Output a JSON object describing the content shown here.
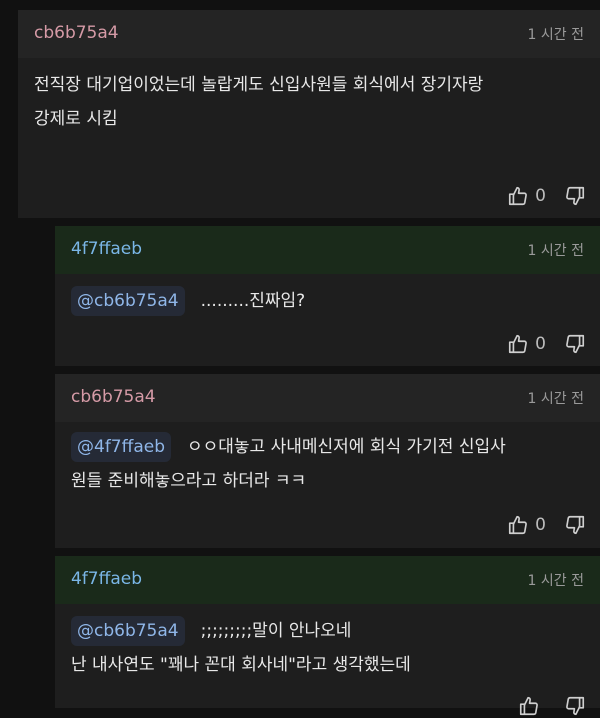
{
  "comments": [
    {
      "author": "cb6b75a4",
      "time": "1 시간 전",
      "lines": [
        "전직장 대기업이었는데 놀랍게도 신입사원들 회식에서 장기자랑",
        "강제로 시킴"
      ],
      "likes": "0"
    },
    {
      "author": "4f7ffaeb",
      "time": "1 시간 전",
      "mention": "@cb6b75a4",
      "lines": [
        ".........진짜임?"
      ],
      "likes": "0"
    },
    {
      "author": "cb6b75a4",
      "time": "1 시간 전",
      "mention": "@4f7ffaeb",
      "lines": [
        "ㅇㅇ대놓고 사내메신저에 회식 가기전 신입사",
        "원들 준비해놓으라고 하더라 ㅋㅋ"
      ],
      "likes": "0"
    },
    {
      "author": "4f7ffaeb",
      "time": "1 시간 전",
      "mention": "@cb6b75a4",
      "lines": [
        ";;;;;;;;;말이 안나오네",
        "난 내사연도 \"꽤나 꼰대 회사네\"라고 생각했는데"
      ],
      "likes": ""
    }
  ],
  "colors": {
    "background": "#111111",
    "card": "#1e1e1e",
    "header_reply": "#1a2a1a",
    "author_original": "#d59aa6",
    "author_reply": "#7ab6e6",
    "mention_text": "#8fb6e8"
  },
  "icons": {
    "like": "thumbs-up-icon",
    "dislike": "thumbs-down-icon"
  }
}
